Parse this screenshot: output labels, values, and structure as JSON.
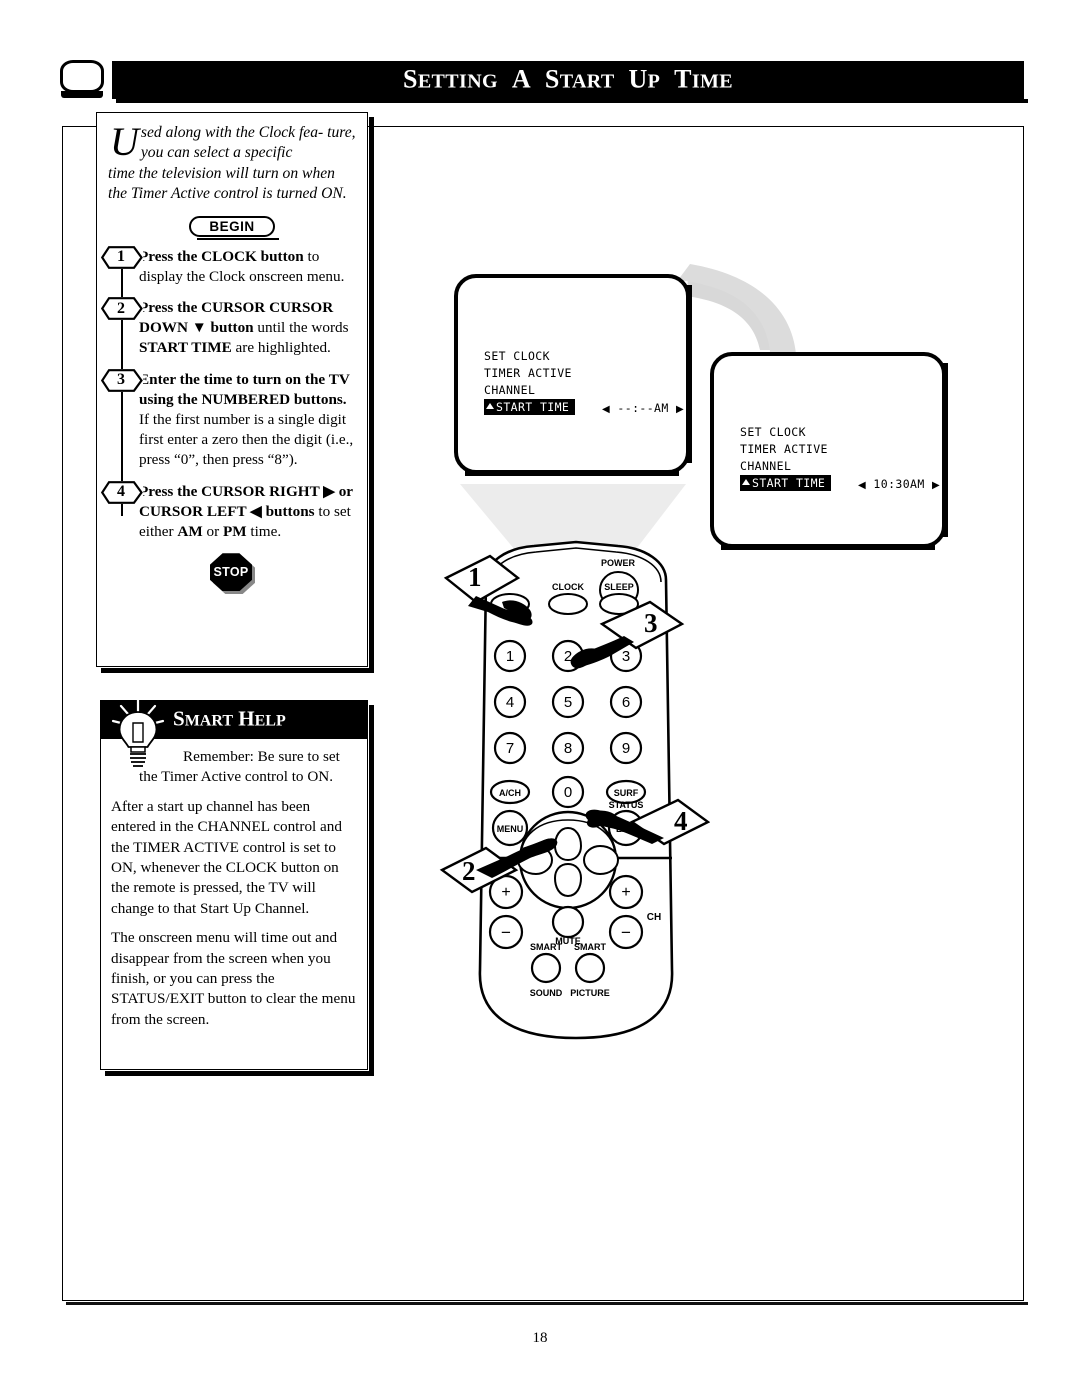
{
  "header": {
    "title_parts": [
      {
        "big": "S",
        "rest": "ETTING"
      },
      {
        "big": "A",
        "rest": ""
      },
      {
        "big": "S",
        "rest": "TART"
      },
      {
        "big": "U",
        "rest": "P"
      },
      {
        "big": "T",
        "rest": "IME"
      }
    ],
    "title_plain": "SETTING A START UP TIME",
    "tv_icon": "television-icon"
  },
  "intro": {
    "dropcap": "U",
    "text": "sed along with the Clock feature, you can select a specific time the television will turn on when the Timer Active control is turned ON.",
    "line1": "sed along with the Clock fea-",
    "line2": "ture, you can select a specific",
    "line3": "time the television will turn on",
    "line4": "when the Timer Active control is",
    "line5": "turned ON."
  },
  "badges": {
    "begin": "BEGIN",
    "stop": "STOP"
  },
  "steps": [
    {
      "number": "1",
      "bold_lead": "Press the CLOCK button",
      "rest": " to display the Clock onscreen menu."
    },
    {
      "number": "2",
      "bold_lead": "Press the CURSOR CURSOR DOWN ▼ button",
      "rest": " until the words ",
      "bold_mid": "START TIME",
      "rest2": " are highlighted."
    },
    {
      "number": "3",
      "bold_lead": "Enter the time to turn on the TV using the NUMBERED buttons.",
      "rest": " If the first number is a single digit first enter a zero then the digit (i.e., press “0”, then press “8”)."
    },
    {
      "number": "4",
      "bold_lead": "Press the CURSOR RIGHT ▶ or CURSOR LEFT ◀ buttons",
      "rest": " to set either ",
      "bold_mid": "AM",
      "rest2": " or ",
      "bold_mid2": "PM",
      "rest3": " time."
    }
  ],
  "smart_help": {
    "title": "SMART HELP",
    "title_s1": "S",
    "title_rest1": "MART",
    "title_s2": "H",
    "title_rest2": "ELP",
    "icon": "lightbulb-icon",
    "paragraphs": [
      "Remember: Be sure to set the Timer Active control to ON.",
      "After a start up channel has been entered in the CHANNEL control and the TIMER ACTIVE control is set to ON, whenever the CLOCK button on the remote is pressed, the TV will change to that Start Up Channel.",
      "The onscreen menu will time out and disappear from the screen when you finish, or you can press the STATUS/EXIT button to clear the menu from the screen."
    ]
  },
  "tv_screens": [
    {
      "id": "tv1",
      "menu_items": [
        "SET CLOCK",
        "TIMER ACTIVE",
        "CHANNEL"
      ],
      "highlighted_item": "START TIME",
      "value": "--:--AM",
      "left_arrow": "◀",
      "right_arrow": "▶"
    },
    {
      "id": "tv2",
      "menu_items": [
        "SET CLOCK",
        "TIMER ACTIVE",
        "CHANNEL"
      ],
      "highlighted_item": "START TIME",
      "value": "10:30AM",
      "left_arrow": "◀",
      "right_arrow": "▶"
    }
  ],
  "remote": {
    "power_label": "POWER",
    "clock_label": "CLOCK",
    "sleep_label": "SLEEP",
    "keypad": [
      "1",
      "2",
      "3",
      "4",
      "5",
      "6",
      "7",
      "8",
      "9"
    ],
    "ach_label": "A/CH",
    "zero_label": "0",
    "surf_label": "SURF",
    "status_label": "STATUS",
    "menu_label": "MENU",
    "exit_label": "EXIT",
    "vol_plus": "+",
    "vol_minus": "–",
    "ch_plus": "+",
    "ch_minus": "–",
    "ch_label": "CH",
    "mute_label": "MUTE",
    "smart_sound_top": "SMART",
    "smart_sound_bottom": "SOUND",
    "smart_picture_top": "SMART",
    "smart_picture_bottom": "PICTURE"
  },
  "callouts": [
    {
      "number": "1",
      "target": "clock-button"
    },
    {
      "number": "2",
      "target": "cursor-down-button"
    },
    {
      "number": "3",
      "target": "numbered-buttons"
    },
    {
      "number": "4",
      "target": "cursor-right-button"
    }
  ],
  "footer": {
    "page_number": "18"
  },
  "colors": {
    "ink": "#000000",
    "paper": "#ffffff",
    "beam_grey": "#e8e8e8",
    "swoosh_grey": "#d9d9d9"
  }
}
